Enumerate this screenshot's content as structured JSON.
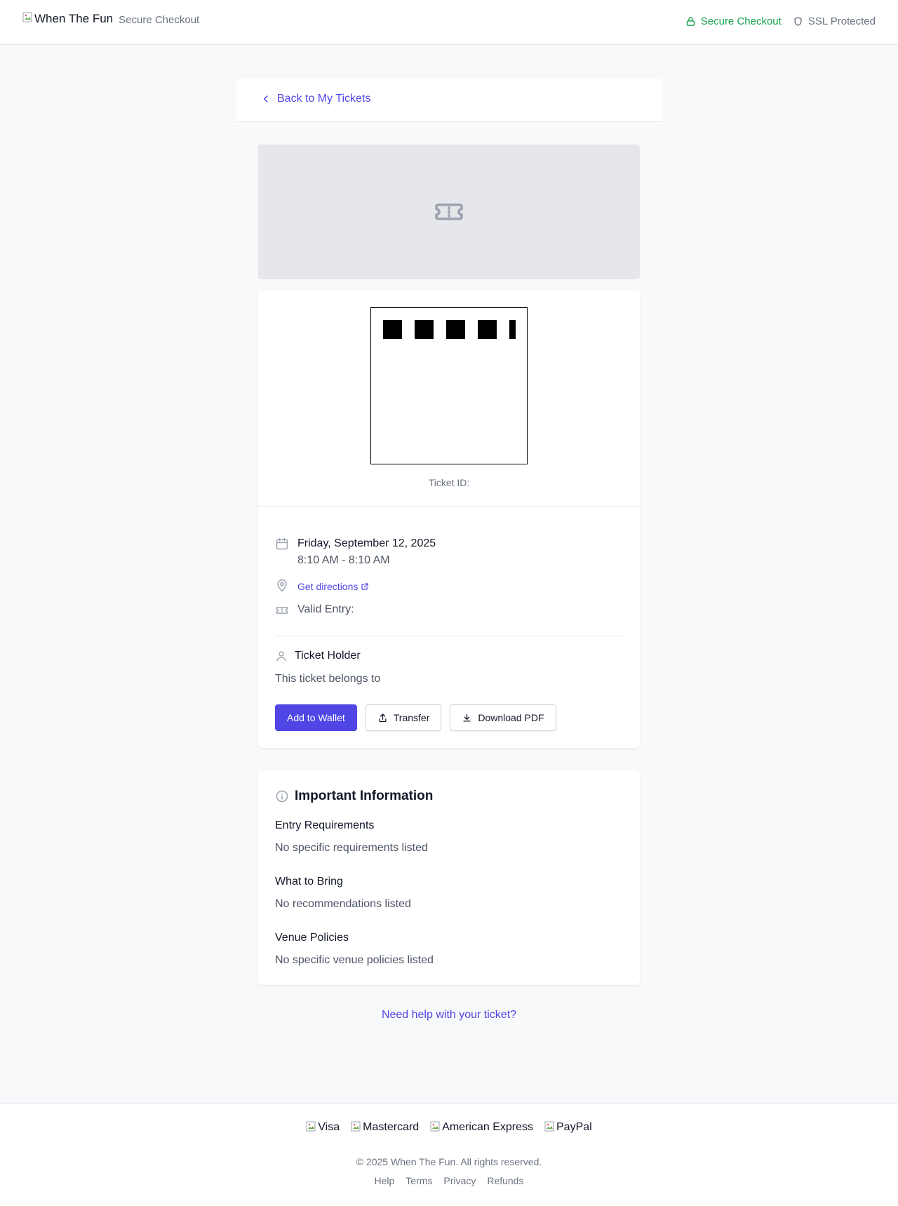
{
  "header": {
    "logo_alt": "When The Fun",
    "subtitle": "Secure Checkout",
    "secure_label": "Secure Checkout",
    "ssl_label": "SSL Protected"
  },
  "nav": {
    "back_label": "Back to My Tickets"
  },
  "ticket": {
    "id_label": "Ticket ID:",
    "date": "Friday, September 12, 2025",
    "time": "8:10 AM - 8:10 AM",
    "directions_label": "Get directions",
    "valid_entry_label": "Valid Entry:",
    "holder_title": "Ticket Holder",
    "holder_text": "This ticket belongs to",
    "buttons": {
      "wallet": "Add to Wallet",
      "transfer": "Transfer",
      "download": "Download PDF"
    }
  },
  "info": {
    "title": "Important Information",
    "sections": [
      {
        "title": "Entry Requirements",
        "text": "No specific requirements listed"
      },
      {
        "title": "What to Bring",
        "text": "No recommendations listed"
      },
      {
        "title": "Venue Policies",
        "text": "No specific venue policies listed"
      }
    ]
  },
  "help_label": "Need help with your ticket?",
  "footer": {
    "payment_methods": [
      "Visa",
      "Mastercard",
      "American Express",
      "PayPal"
    ],
    "copyright": "© 2025 When The Fun. All rights reserved.",
    "links": [
      "Help",
      "Terms",
      "Privacy",
      "Refunds"
    ]
  },
  "colors": {
    "accent": "#4f46e5",
    "success": "#16a34a",
    "muted": "#6b7280"
  },
  "icons": [
    "lock-icon",
    "shield-icon",
    "chevron-left-icon",
    "ticket-icon",
    "calendar-icon",
    "map-pin-icon",
    "external-link-icon",
    "user-icon",
    "share-icon",
    "download-icon",
    "info-icon"
  ]
}
